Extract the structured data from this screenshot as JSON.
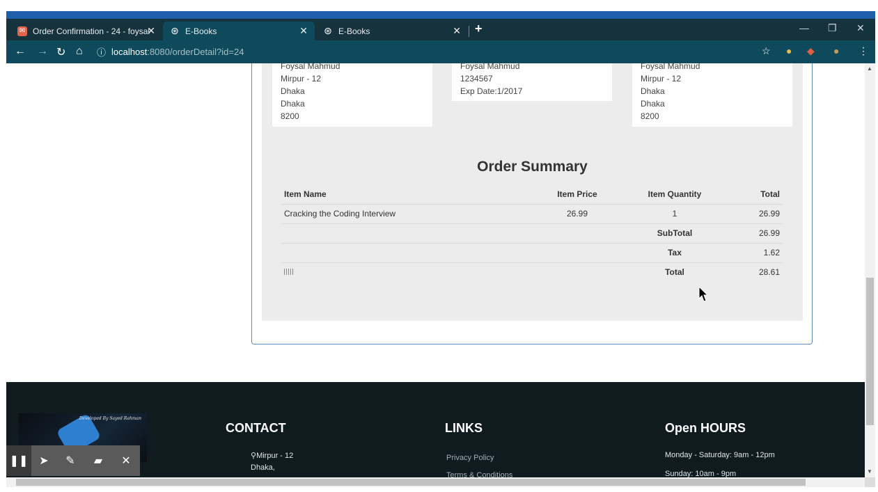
{
  "browser": {
    "tabs": [
      {
        "title": "Order Confirmation - 24 - foysal",
        "icon": "gmail-icon"
      },
      {
        "title": "E-Books",
        "icon": "globe-icon"
      },
      {
        "title": "E-Books",
        "icon": "globe-icon"
      }
    ],
    "url_host": "localhost",
    "url_path": ":8080/orderDetail?id=24"
  },
  "addresses": {
    "billing": [
      "Foysal Mahmud",
      "Mirpur - 12",
      "Dhaka",
      "Dhaka",
      "8200"
    ],
    "payment": [
      "Foysal Mahmud",
      "1234567",
      "Exp Date:1/2017"
    ],
    "shipping": [
      "Foysal Mahmud",
      "Mirpur - 12",
      "Dhaka",
      "Dhaka",
      "8200"
    ]
  },
  "summary": {
    "title": "Order Summary",
    "headers": {
      "name": "Item Name",
      "price": "Item Price",
      "qty": "Item Quantity",
      "total": "Total"
    },
    "items": [
      {
        "name": "Cracking the Coding Interview",
        "price": "26.99",
        "qty": "1",
        "total": "26.99"
      }
    ],
    "subtotal_label": "SubTotal",
    "subtotal": "26.99",
    "tax_label": "Tax",
    "tax": "1.62",
    "total_label": "Total",
    "total": "28.61"
  },
  "footer": {
    "logo_text": "Developed By Sayed Rahman",
    "contact_head": "CONTACT",
    "contact_lines": [
      "Mirpur - 12",
      "Dhaka,"
    ],
    "links_head": "LINKS",
    "links": [
      "Privacy Policy",
      "Terms & Conditions"
    ],
    "hours_head": "Open HOURS",
    "hours": [
      "Monday - Saturday: 9am - 12pm",
      "Sunday: 10am - 9pm"
    ]
  }
}
